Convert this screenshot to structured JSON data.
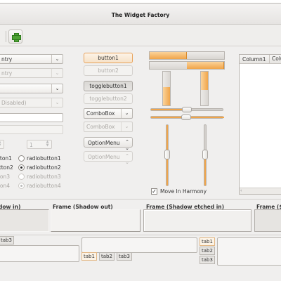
{
  "window": {
    "title": "The Widget Factory"
  },
  "toolbar": {
    "add_icon": "list-add-icon"
  },
  "left": {
    "combo_entry_text": "ntry",
    "combo_entry_disabled_text": "ntry",
    "combo_disabled_text": "Disabled)",
    "spin_disabled_value": "1",
    "radios_col1": [
      "ttton1",
      "utton2",
      "tton3",
      "tton4"
    ],
    "radios_col2": [
      "radiobutton1",
      "radiobutton2",
      "radiobutton3",
      "radiobutton4"
    ]
  },
  "middle": {
    "button1": "button1",
    "button2": "button2",
    "togglebutton1": "togglebutton1",
    "togglebutton2": "togglebutton2",
    "combobox1": "ComboBox",
    "combobox2": "ComboBox",
    "optionmenu1": "OptionMenu",
    "optionmenu2": "OptionMenu"
  },
  "right": {
    "progress": {
      "h1": 0.5,
      "h2": 0.5,
      "v1": 0.55,
      "v2": 0.55
    },
    "move_in_harmony": "Move In Harmony",
    "move_in_harmony_checked": true
  },
  "tree": {
    "columns": [
      "Column1",
      "Colu"
    ]
  },
  "frames": {
    "shadow_in": "dow in)",
    "shadow_out": "Frame (Shadow out)",
    "shadow_etched_in": "Frame (Shadow etched in)",
    "shadow_etched_out": "Frame ($"
  },
  "notebooks": {
    "nb1_tabs": [
      "tab3"
    ],
    "nb2_tabs": [
      "tab1",
      "tab2",
      "tab3"
    ],
    "nb3_tabs": [
      "tab1",
      "tab2",
      "tab3"
    ]
  },
  "colors": {
    "accent": "#f0a54a",
    "background": "#f0efee",
    "add_green": "#4ea235"
  }
}
